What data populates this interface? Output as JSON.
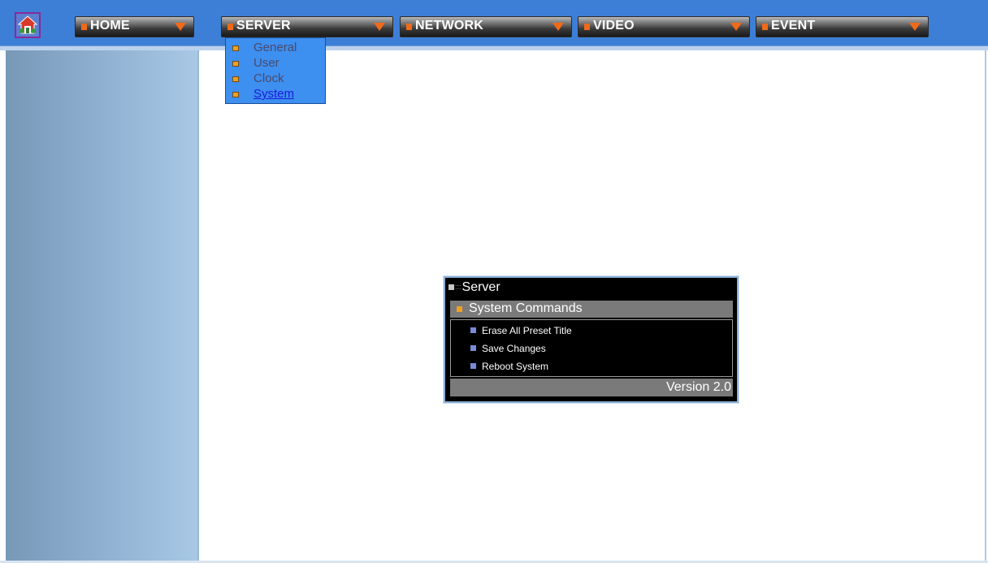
{
  "nav": {
    "home_label": "HOME",
    "server_label": "SERVER",
    "network_label": "NETWORK",
    "video_label": "VIDEO",
    "event_label": "EVENT"
  },
  "dropdown": {
    "items": [
      {
        "label": "General"
      },
      {
        "label": "User"
      },
      {
        "label": "Clock"
      },
      {
        "label": "System"
      }
    ]
  },
  "panel": {
    "title": "Server",
    "section": "System Commands",
    "commands": [
      {
        "label": "Erase All Preset Title"
      },
      {
        "label": "Save Changes"
      },
      {
        "label": "Reboot System"
      }
    ],
    "version": "Version 2.0"
  },
  "colors": {
    "topbar": "#3d7fd6",
    "accent": "#f06a1a",
    "dropdown_bg": "#3d8ff0",
    "link": "#1a1ad8"
  },
  "icons": {
    "logo": "house-icon",
    "nav_marker": "orange-square-icon",
    "nav_arrow": "dropdown-triangle-icon"
  }
}
